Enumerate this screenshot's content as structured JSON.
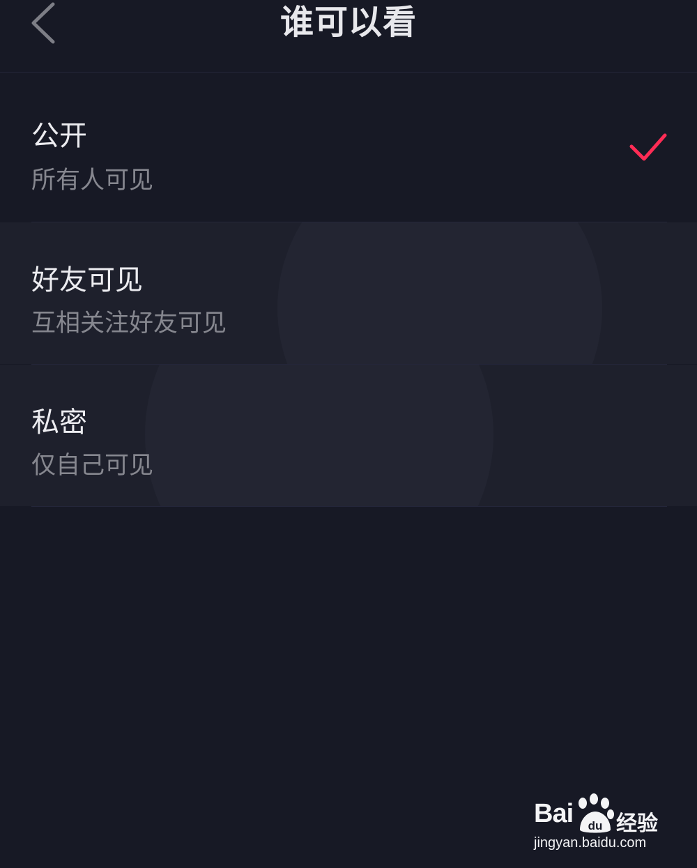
{
  "header": {
    "title": "谁可以看",
    "back_icon": "chevron-left-icon"
  },
  "options": [
    {
      "label": "公开",
      "description": "所有人可见",
      "selected": true
    },
    {
      "label": "好友可见",
      "description": "互相关注好友可见",
      "selected": false
    },
    {
      "label": "私密",
      "description": "仅自己可见",
      "selected": false
    }
  ],
  "check_icon": "checkmark-icon",
  "colors": {
    "background": "#171925",
    "accent": "#fe2c55",
    "primary_text": "#ececf0",
    "secondary_text": "#86878f"
  },
  "watermark": {
    "logo_text": "Bai",
    "logo_du": "du",
    "jingyan": "经验",
    "url": "jingyan.baidu.com"
  }
}
